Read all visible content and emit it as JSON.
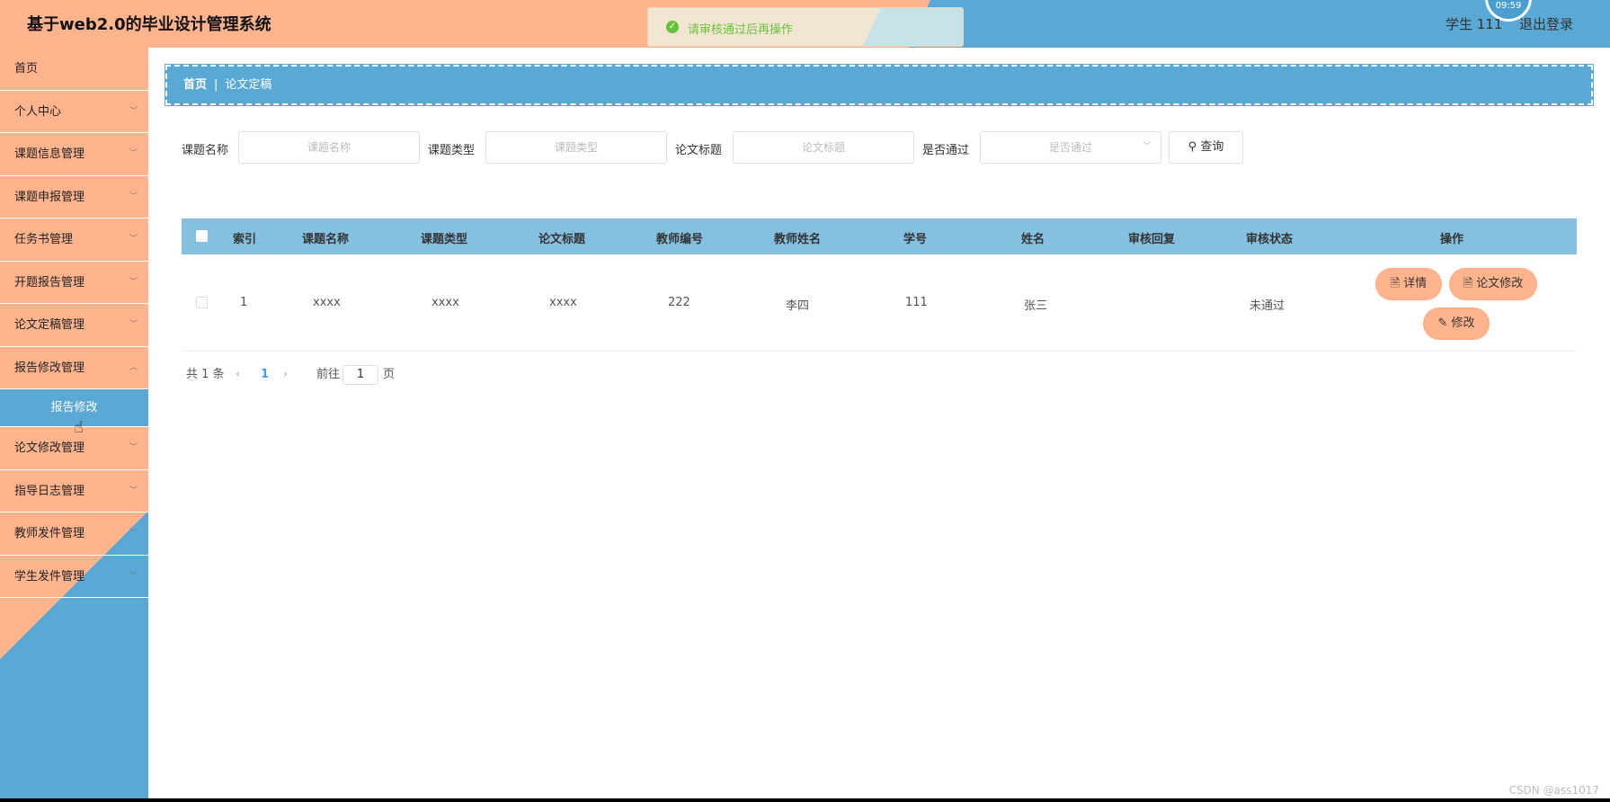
{
  "header": {
    "title": "基于web2.0的毕业设计管理系统",
    "user": "学生 111",
    "logout": "退出登录",
    "clock": "09:59"
  },
  "toast": {
    "message": "请审核通过后再操作"
  },
  "sidebar": {
    "items": [
      {
        "label": "首页"
      },
      {
        "label": "个人中心"
      },
      {
        "label": "课题信息管理"
      },
      {
        "label": "课题申报管理"
      },
      {
        "label": "任务书管理"
      },
      {
        "label": "开题报告管理"
      },
      {
        "label": "论文定稿管理"
      },
      {
        "label": "报告修改管理"
      },
      {
        "label": "报告修改"
      },
      {
        "label": "论文修改管理"
      },
      {
        "label": "指导日志管理"
      },
      {
        "label": "教师发件管理"
      },
      {
        "label": "学生发件管理"
      }
    ]
  },
  "breadcrumb": {
    "home": "首页",
    "current": "论文定稿"
  },
  "search": {
    "topic_label": "课题名称",
    "topic_placeholder": "课题名称",
    "type_label": "课题类型",
    "type_placeholder": "课题类型",
    "paper_label": "论文标题",
    "paper_placeholder": "论文标题",
    "pass_label": "是否通过",
    "pass_placeholder": "是否通过",
    "query_button": "查询"
  },
  "table": {
    "headers": [
      "索引",
      "课题名称",
      "课题类型",
      "论文标题",
      "教师编号",
      "教师姓名",
      "学号",
      "姓名",
      "审核回复",
      "审核状态",
      "操作"
    ],
    "rows": [
      {
        "index": "1",
        "topic": "xxxx",
        "type": "xxxx",
        "paper": "xxxx",
        "teacher_no": "222",
        "teacher_name": "李四",
        "student_no": "111",
        "name": "张三",
        "reply": "",
        "status": "未通过"
      }
    ],
    "actions": {
      "detail": "详情",
      "paper_edit": "论文修改",
      "edit": "修改"
    }
  },
  "pagination": {
    "total": "共 1 条",
    "current": "1",
    "goto_prefix": "前往",
    "goto_value": "1",
    "goto_suffix": "页"
  },
  "watermark": "CSDN @ass1017",
  "colors": {
    "peach": "#ffb48e",
    "blue": "#5aa8d4",
    "table_head": "#85c0e0"
  }
}
